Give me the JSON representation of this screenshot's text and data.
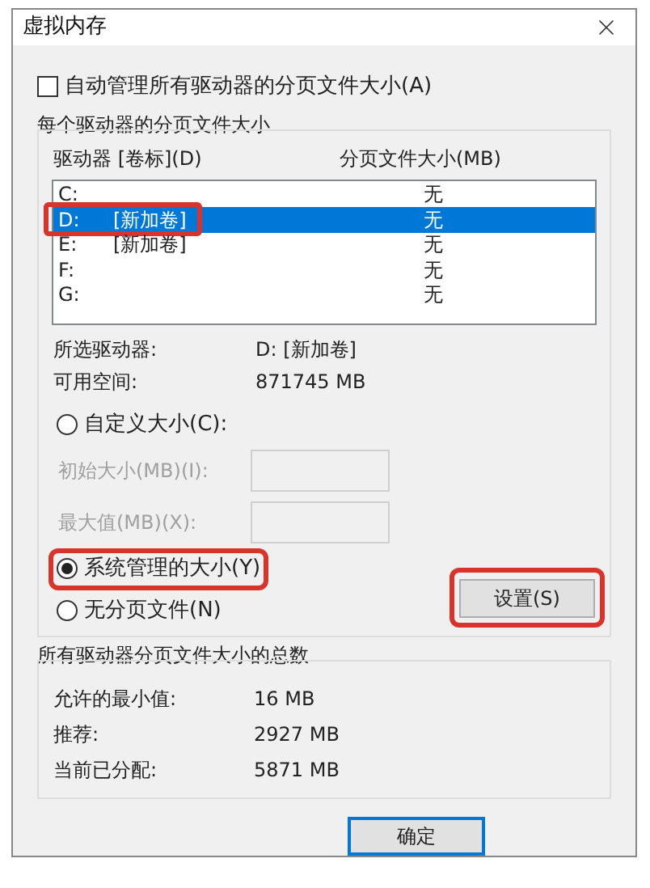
{
  "window": {
    "title": "虚拟内存"
  },
  "auto_manage": {
    "label": "自动管理所有驱动器的分页文件大小(A)",
    "checked": false
  },
  "per_drive": {
    "title": "每个驱动器的分页文件大小",
    "columns": [
      "驱动器 [卷标](D)",
      "分页文件大小(MB)"
    ],
    "drives": [
      {
        "drive": "C:",
        "size": "无",
        "selected": false,
        "highlighted": false
      },
      {
        "drive": "D:",
        "volume": "[新加卷]",
        "size": "无",
        "selected": true,
        "highlighted": true
      },
      {
        "drive": "E:",
        "volume": "[新加卷]",
        "size": "无",
        "selected": false,
        "highlighted": false
      },
      {
        "drive": "F:",
        "size": "无",
        "selected": false,
        "highlighted": false
      },
      {
        "drive": "G:",
        "size": "无",
        "selected": false,
        "highlighted": false
      }
    ],
    "info": [
      {
        "label": "所选驱动器:",
        "value": "D:  [新加卷]"
      },
      {
        "label": "可用空间:",
        "value": "871745 MB"
      }
    ],
    "options": [
      {
        "kind": "radio",
        "label": "自定义大小(C):",
        "selected": false,
        "highlighted": false
      },
      {
        "kind": "field",
        "label": "初始大小(MB)(I):",
        "disabled": true
      },
      {
        "kind": "field",
        "label": "最大值(MB)(X):",
        "disabled": true
      },
      {
        "kind": "radio",
        "label": "系统管理的大小(Y)",
        "selected": true,
        "highlighted": true
      },
      {
        "kind": "radio",
        "label": "无分页文件(N)",
        "selected": false,
        "highlighted": false
      }
    ],
    "set_button": {
      "label": "设置(S)",
      "highlighted": true
    }
  },
  "totals": {
    "title": "所有驱动器分页文件大小的总数",
    "rows": [
      {
        "label": "允许的最小值:",
        "value": "16 MB"
      },
      {
        "label": "推荐:",
        "value": "2927 MB"
      },
      {
        "label": "当前已分配:",
        "value": "5871 MB"
      }
    ]
  },
  "ok_button": {
    "label": "确定"
  }
}
